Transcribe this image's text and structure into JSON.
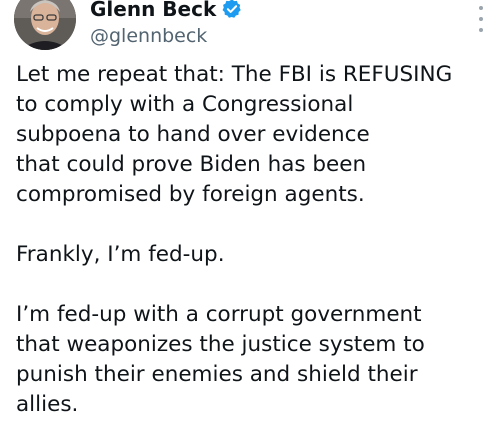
{
  "tweet": {
    "author": {
      "display_name": "Glenn Beck",
      "handle": "@glennbeck",
      "verified": true,
      "avatar_icon": "person-photo-avatar"
    },
    "menu_icon": "more-vertical-icon",
    "paragraphs": [
      "Let me repeat that: The FBI is REFUSING\nto comply with a Congressional\nsubpoena to hand over evidence\nthat could prove Biden has been\ncompromised by foreign agents.",
      "Frankly, I’m fed-up.",
      "I’m fed-up with a corrupt government\nthat weaponizes the justice system to\npunish their enemies and shield their\nallies."
    ]
  },
  "colors": {
    "text": "#0f1419",
    "secondary": "#536471",
    "verified": "#1d9bf0"
  }
}
